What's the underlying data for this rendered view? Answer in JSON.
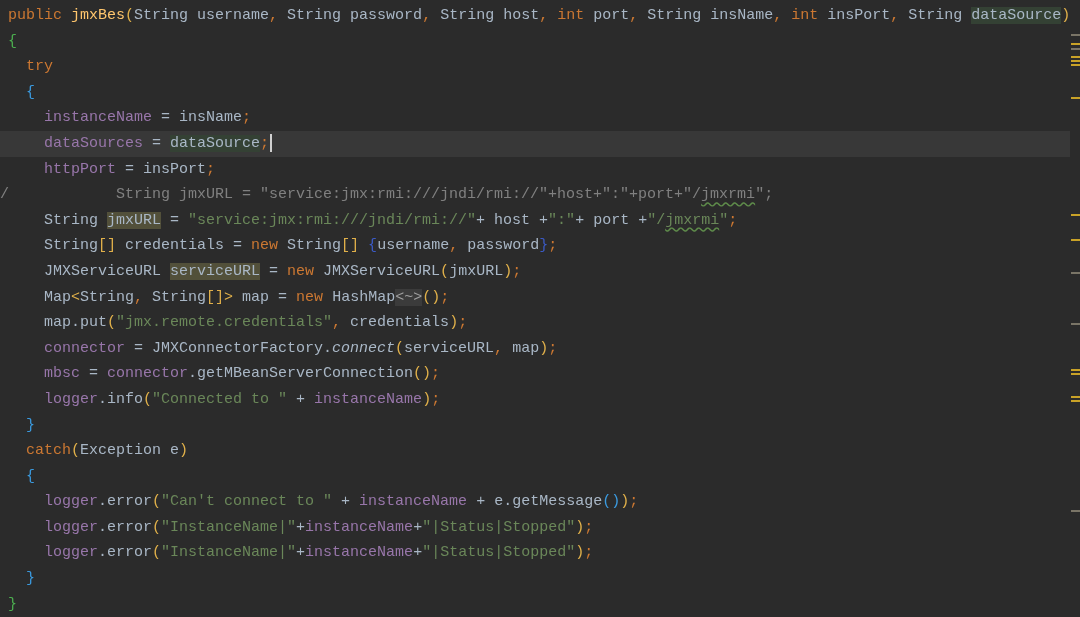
{
  "editor": {
    "lines": [
      {
        "current": false,
        "tokens": [
          {
            "text": "public",
            "kind": "keyword"
          },
          {
            "text": " jmxBes",
            "kind": "method"
          },
          {
            "text": "(",
            "kind": "paren"
          },
          {
            "text": "String username",
            "kind": "plain"
          },
          {
            "text": ",",
            "kind": "keyword"
          },
          {
            "text": " String password",
            "kind": "plain"
          },
          {
            "text": ",",
            "kind": "keyword"
          },
          {
            "text": " String host",
            "kind": "plain"
          },
          {
            "text": ",",
            "kind": "keyword"
          },
          {
            "text": " int",
            "kind": "keyword"
          },
          {
            "text": " port",
            "kind": "plain"
          },
          {
            "text": ",",
            "kind": "keyword"
          },
          {
            "text": " String insName",
            "kind": "plain"
          },
          {
            "text": ",",
            "kind": "keyword"
          },
          {
            "text": " int",
            "kind": "keyword"
          },
          {
            "text": " insPort",
            "kind": "plain"
          },
          {
            "text": ",",
            "kind": "keyword"
          },
          {
            "text": " String ",
            "kind": "plain"
          },
          {
            "text": "dataSource",
            "kind": "write-highlight"
          },
          {
            "text": ")",
            "kind": "paren"
          }
        ]
      },
      {
        "current": false,
        "tokens": [
          {
            "text": "{",
            "kind": "brace-green"
          }
        ],
        "children": [
          {
            "current": false,
            "tokens": [
              {
                "text": "try",
                "kind": "keyword"
              }
            ]
          },
          {
            "current": false,
            "tokens": [
              {
                "text": "{",
                "kind": "brace-blue"
              }
            ],
            "children": [
              {
                "current": false,
                "tokens": [
                  {
                    "text": "instanceName",
                    "kind": "field"
                  },
                  {
                    "text": " = insName",
                    "kind": "plain"
                  },
                  {
                    "text": ";",
                    "kind": "keyword"
                  }
                ]
              },
              {
                "current": true,
                "tokens": [
                  {
                    "text": "dataSources",
                    "kind": "field"
                  },
                  {
                    "text": " = ",
                    "kind": "plain"
                  },
                  {
                    "text": "dataSource",
                    "kind": "write-highlight"
                  },
                  {
                    "text": ";",
                    "kind": "keyword"
                  }
                ]
              },
              {
                "current": false,
                "tokens": [
                  {
                    "text": "httpPort",
                    "kind": "field"
                  },
                  {
                    "text": " = insPort",
                    "kind": "plain"
                  },
                  {
                    "text": ";",
                    "kind": "keyword"
                  }
                ]
              },
              {
                "current": false,
                "tokens": [
                  {
                    "text": "/",
                    "kind": "gutter-slash"
                  },
                  {
                    "text": "        String jmxURL = \"service:jmx:rmi:///jndi/rmi://\"+host+\":\"+port+\"/",
                    "kind": "comment"
                  },
                  {
                    "text": "jmxrmi",
                    "kind": "comment-typo"
                  },
                  {
                    "text": "\";",
                    "kind": "comment"
                  }
                ]
              },
              {
                "current": false,
                "tokens": [
                  {
                    "text": "String ",
                    "kind": "plain"
                  },
                  {
                    "text": "jmxURL",
                    "kind": "usage-highlight"
                  },
                  {
                    "text": " = ",
                    "kind": "plain"
                  },
                  {
                    "text": "\"service:jmx:rmi:///jndi/rmi://\"",
                    "kind": "string"
                  },
                  {
                    "text": "+ host +",
                    "kind": "plain"
                  },
                  {
                    "text": "\":\"",
                    "kind": "string"
                  },
                  {
                    "text": "+ port +",
                    "kind": "plain"
                  },
                  {
                    "text": "\"/",
                    "kind": "string"
                  },
                  {
                    "text": "jmxrmi",
                    "kind": "typo"
                  },
                  {
                    "text": "\"",
                    "kind": "string"
                  },
                  {
                    "text": ";",
                    "kind": "keyword"
                  }
                ]
              },
              {
                "current": false,
                "tokens": [
                  {
                    "text": "String",
                    "kind": "plain"
                  },
                  {
                    "text": "[]",
                    "kind": "paren"
                  },
                  {
                    "text": " credentials = ",
                    "kind": "plain"
                  },
                  {
                    "text": "new",
                    "kind": "keyword"
                  },
                  {
                    "text": " String",
                    "kind": "plain"
                  },
                  {
                    "text": "[]",
                    "kind": "paren"
                  },
                  {
                    "text": " {",
                    "kind": "brace-dark"
                  },
                  {
                    "text": "username",
                    "kind": "plain"
                  },
                  {
                    "text": ",",
                    "kind": "keyword"
                  },
                  {
                    "text": " password",
                    "kind": "plain"
                  },
                  {
                    "text": "}",
                    "kind": "brace-dark"
                  },
                  {
                    "text": ";",
                    "kind": "keyword"
                  }
                ]
              },
              {
                "current": false,
                "tokens": [
                  {
                    "text": "JMXServiceURL ",
                    "kind": "plain"
                  },
                  {
                    "text": "serviceURL",
                    "kind": "usage-highlight"
                  },
                  {
                    "text": " = ",
                    "kind": "plain"
                  },
                  {
                    "text": "new",
                    "kind": "keyword"
                  },
                  {
                    "text": " JMXServiceURL",
                    "kind": "plain"
                  },
                  {
                    "text": "(",
                    "kind": "paren"
                  },
                  {
                    "text": "jmxURL",
                    "kind": "plain"
                  },
                  {
                    "text": ")",
                    "kind": "paren"
                  },
                  {
                    "text": ";",
                    "kind": "keyword"
                  }
                ]
              },
              {
                "current": false,
                "tokens": [
                  {
                    "text": "Map",
                    "kind": "plain"
                  },
                  {
                    "text": "<",
                    "kind": "paren"
                  },
                  {
                    "text": "String",
                    "kind": "plain"
                  },
                  {
                    "text": ",",
                    "kind": "keyword"
                  },
                  {
                    "text": " String",
                    "kind": "plain"
                  },
                  {
                    "text": "[]>",
                    "kind": "paren"
                  },
                  {
                    "text": " map = ",
                    "kind": "plain"
                  },
                  {
                    "text": "new",
                    "kind": "keyword"
                  },
                  {
                    "text": " HashMap",
                    "kind": "plain"
                  },
                  {
                    "text": "<~>",
                    "kind": "fold"
                  },
                  {
                    "text": "()",
                    "kind": "paren"
                  },
                  {
                    "text": ";",
                    "kind": "keyword"
                  }
                ]
              },
              {
                "current": false,
                "tokens": [
                  {
                    "text": "map.put",
                    "kind": "plain"
                  },
                  {
                    "text": "(",
                    "kind": "paren"
                  },
                  {
                    "text": "\"jmx.remote.credentials\"",
                    "kind": "string"
                  },
                  {
                    "text": ",",
                    "kind": "keyword"
                  },
                  {
                    "text": " credentials",
                    "kind": "plain"
                  },
                  {
                    "text": ")",
                    "kind": "paren"
                  },
                  {
                    "text": ";",
                    "kind": "keyword"
                  }
                ]
              },
              {
                "current": false,
                "tokens": [
                  {
                    "text": "connector",
                    "kind": "field"
                  },
                  {
                    "text": " = JMXConnectorFactory.",
                    "kind": "plain"
                  },
                  {
                    "text": "connect",
                    "kind": "italic"
                  },
                  {
                    "text": "(",
                    "kind": "paren"
                  },
                  {
                    "text": "serviceURL",
                    "kind": "plain"
                  },
                  {
                    "text": ",",
                    "kind": "keyword"
                  },
                  {
                    "text": " map",
                    "kind": "plain"
                  },
                  {
                    "text": ")",
                    "kind": "paren"
                  },
                  {
                    "text": ";",
                    "kind": "keyword"
                  }
                ]
              },
              {
                "current": false,
                "tokens": [
                  {
                    "text": "mbsc",
                    "kind": "field"
                  },
                  {
                    "text": " = ",
                    "kind": "plain"
                  },
                  {
                    "text": "connector",
                    "kind": "field"
                  },
                  {
                    "text": ".getMBeanServerConnection",
                    "kind": "plain"
                  },
                  {
                    "text": "()",
                    "kind": "paren"
                  },
                  {
                    "text": ";",
                    "kind": "keyword"
                  }
                ]
              },
              {
                "current": false,
                "tokens": [
                  {
                    "text": "logger",
                    "kind": "field"
                  },
                  {
                    "text": ".info",
                    "kind": "plain"
                  },
                  {
                    "text": "(",
                    "kind": "paren"
                  },
                  {
                    "text": "\"Connected to \"",
                    "kind": "string"
                  },
                  {
                    "text": " + ",
                    "kind": "plain"
                  },
                  {
                    "text": "instanceName",
                    "kind": "field"
                  },
                  {
                    "text": ")",
                    "kind": "paren"
                  },
                  {
                    "text": ";",
                    "kind": "keyword"
                  }
                ]
              }
            ]
          },
          {
            "current": false,
            "tokens": [
              {
                "text": "}",
                "kind": "brace-blue"
              }
            ]
          },
          {
            "current": false,
            "tokens": [
              {
                "text": "catch",
                "kind": "keyword"
              },
              {
                "text": "(",
                "kind": "paren"
              },
              {
                "text": "Exception e",
                "kind": "plain"
              },
              {
                "text": ")",
                "kind": "paren"
              }
            ]
          },
          {
            "current": false,
            "tokens": [
              {
                "text": "{",
                "kind": "brace-blue"
              }
            ],
            "children": [
              {
                "current": false,
                "tokens": [
                  {
                    "text": "logger",
                    "kind": "field"
                  },
                  {
                    "text": ".error",
                    "kind": "plain"
                  },
                  {
                    "text": "(",
                    "kind": "paren"
                  },
                  {
                    "text": "\"Can't connect to \"",
                    "kind": "string"
                  },
                  {
                    "text": " + ",
                    "kind": "plain"
                  },
                  {
                    "text": "instanceName",
                    "kind": "field"
                  },
                  {
                    "text": " + e.getMessage",
                    "kind": "plain"
                  },
                  {
                    "text": "()",
                    "kind": "brace-blue"
                  },
                  {
                    "text": ")",
                    "kind": "paren"
                  },
                  {
                    "text": ";",
                    "kind": "keyword"
                  }
                ]
              },
              {
                "current": false,
                "tokens": [
                  {
                    "text": "logger",
                    "kind": "field"
                  },
                  {
                    "text": ".error",
                    "kind": "plain"
                  },
                  {
                    "text": "(",
                    "kind": "paren"
                  },
                  {
                    "text": "\"InstanceName|\"",
                    "kind": "string"
                  },
                  {
                    "text": "+",
                    "kind": "plain"
                  },
                  {
                    "text": "instanceName",
                    "kind": "field"
                  },
                  {
                    "text": "+",
                    "kind": "plain"
                  },
                  {
                    "text": "\"|Status|Stopped\"",
                    "kind": "string"
                  },
                  {
                    "text": ")",
                    "kind": "paren"
                  },
                  {
                    "text": ";",
                    "kind": "keyword"
                  }
                ]
              },
              {
                "current": false,
                "tokens": [
                  {
                    "text": "logger",
                    "kind": "field"
                  },
                  {
                    "text": ".error",
                    "kind": "plain"
                  },
                  {
                    "text": "(",
                    "kind": "paren"
                  },
                  {
                    "text": "\"InstanceName|\"",
                    "kind": "string"
                  },
                  {
                    "text": "+",
                    "kind": "plain"
                  },
                  {
                    "text": "instanceName",
                    "kind": "field"
                  },
                  {
                    "text": "+",
                    "kind": "plain"
                  },
                  {
                    "text": "\"|Status|Stopped\"",
                    "kind": "string"
                  },
                  {
                    "text": ")",
                    "kind": "paren"
                  },
                  {
                    "text": ";",
                    "kind": "keyword"
                  }
                ]
              }
            ]
          },
          {
            "current": false,
            "tokens": [
              {
                "text": "}",
                "kind": "brace-blue"
              }
            ]
          }
        ]
      },
      {
        "current": false,
        "tokens": [
          {
            "text": "}",
            "kind": "brace-green"
          }
        ]
      }
    ]
  }
}
